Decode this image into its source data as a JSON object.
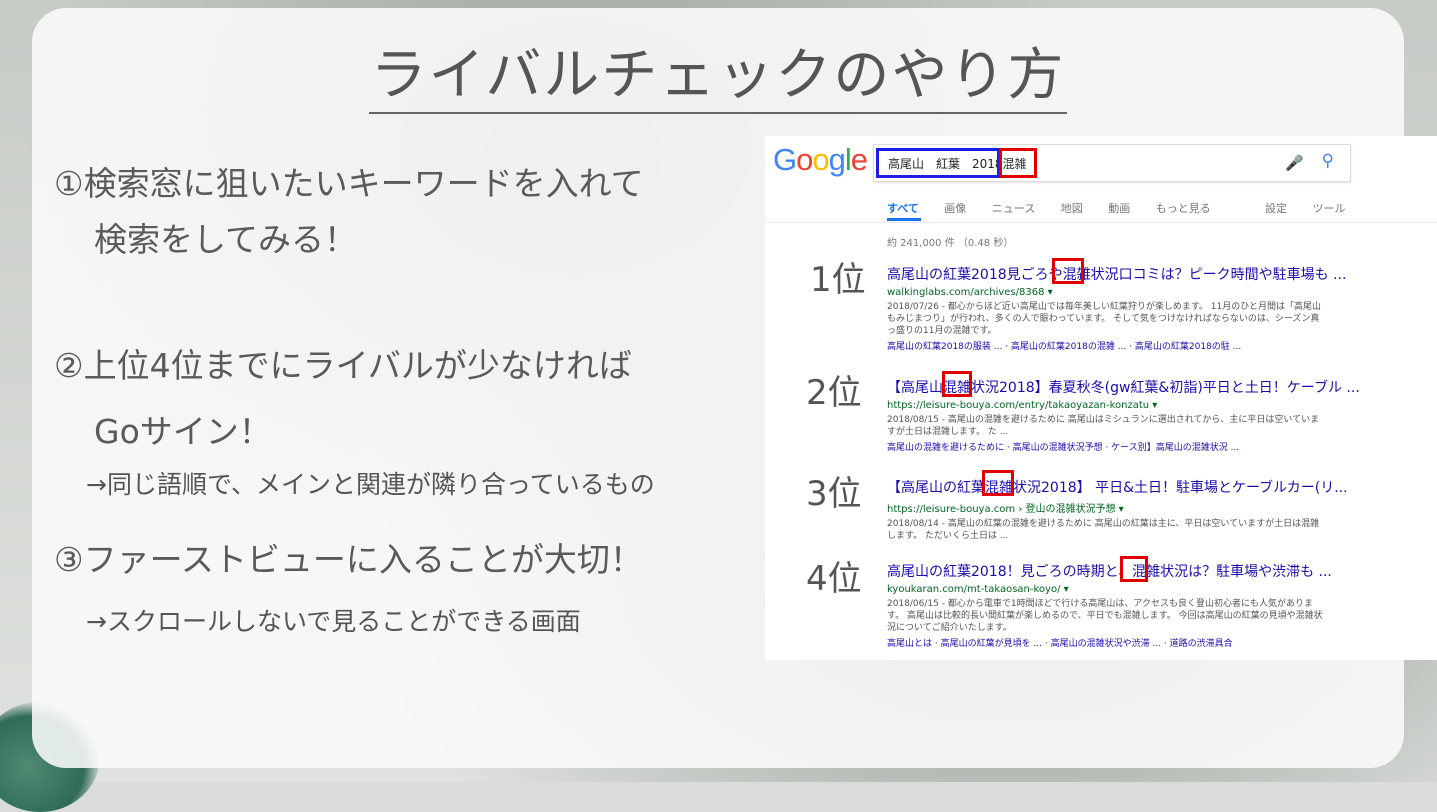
{
  "slide": {
    "title": "ライバルチェックのやり方",
    "step1_line1": "①検索窓に狙いたいキーワードを入れて",
    "step1_line2": "検索をしてみる！",
    "step2_line1": "②上位4位までにライバルが少なければ",
    "step2_line2": "Goサイン！",
    "step2_note": "→同じ語順で、メインと関連が隣り合っているもの",
    "step3_line1": "③ファーストビューに入ることが大切！",
    "step3_note": "→スクロールしないで見ることができる画面",
    "ranks": [
      "1位",
      "2位",
      "3位",
      "4位"
    ]
  },
  "google": {
    "logo": "Google",
    "query_main": "高尾山　紅葉　2018",
    "query_extra": "混雑",
    "tabs": [
      "すべて",
      "画像",
      "ニュース",
      "地図",
      "動画",
      "もっと見る"
    ],
    "tabs_right": [
      "設定",
      "ツール"
    ],
    "stats": "約 241,000 件 （0.48 秒）",
    "results": [
      {
        "title": "高尾山の紅葉2018見ごろや混雑状況口コミは？ピーク時間や駐車場も ...",
        "url": "walkinglabs.com/archives/8368 ▾",
        "snippet": "2018/07/26 - 都心からほど近い高尾山では毎年美しい紅葉狩りが楽しめます。 11月のひと月間は「高尾山もみじまつり」が行われ、多くの人で賑わっています。 そして気をつけなければならないのは、シーズン真っ盛りの11月の混雑です。",
        "links": "高尾山の紅葉2018の服装 ... · 高尾山の紅葉2018の混雑 ... · 高尾山の紅葉2018の駐 ..."
      },
      {
        "title": "【高尾山混雑状況2018】春夏秋冬(gw紅葉&初詣)平日と土日！ケーブル ...",
        "url": "https://leisure-bouya.com/entry/takaoyazan-konzatu ▾",
        "snippet": "2018/08/15 - 高尾山の混雑を避けるために 高尾山はミシュランに選出されてから、主に平日は空いていますが土日は混雑します。 た ...",
        "links": "高尾山の混雑を避けるために · 高尾山の混雑状況予想 · ケース別】高尾山の混雑状況 ..."
      },
      {
        "title": "【高尾山の紅葉混雑状況2018】 平日&土日！駐車場とケーブルカー(リ...",
        "url": "https://leisure-bouya.com › 登山の混雑状況予想 ▾",
        "snippet": "2018/08/14 - 高尾山の紅葉の混雑を避けるために 高尾山の紅葉は主に、平日は空いていますが土日は混雑します。 ただいくら土日は ...",
        "links": ""
      },
      {
        "title": "高尾山の紅葉2018！見ごろの時期と、混雑状況は？駐車場や渋滞も ...",
        "url": "kyoukaran.com/mt-takaosan-koyo/ ▾",
        "snippet": "2018/06/15 - 都心から電車で1時間ほどで行ける高尾山は、アクセスも良く登山初心者にも人気があります。 高尾山は比較的長い間紅葉が楽しめるので、平日でも混雑します。 今回は高尾山の紅葉の見頃や混雑状況についてご紹介いたします。",
        "links": "高尾山とは · 高尾山の紅葉が見頃を ... · 高尾山の混雑状況や渋滞 ... · 道路の渋滞具合"
      }
    ]
  }
}
